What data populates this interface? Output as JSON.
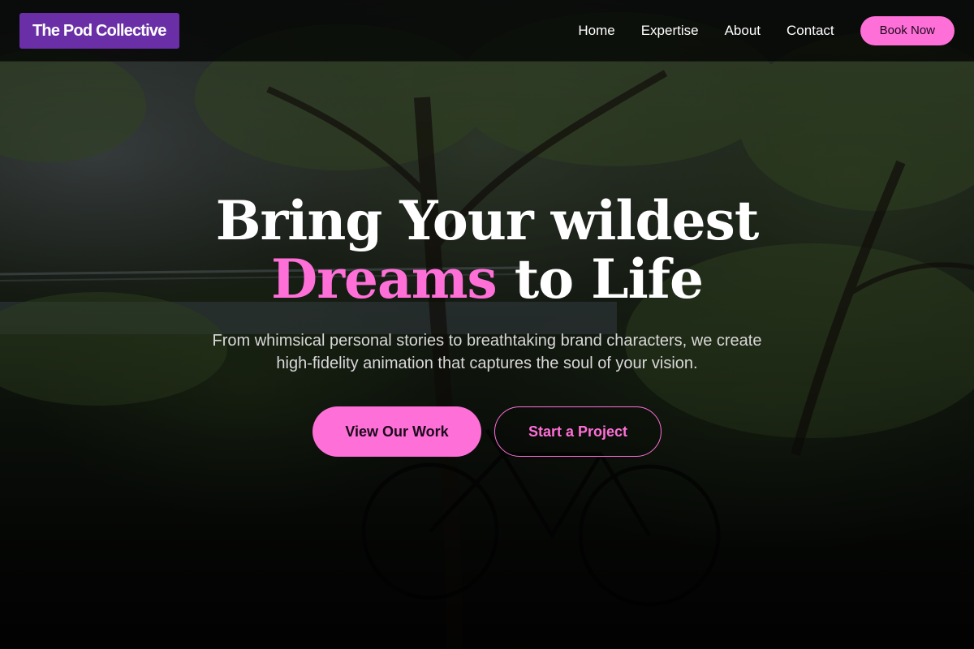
{
  "header": {
    "logo": "The Pod Collective",
    "nav": [
      {
        "label": "Home"
      },
      {
        "label": "Expertise"
      },
      {
        "label": "About"
      },
      {
        "label": "Contact"
      }
    ],
    "book_button": "Book Now"
  },
  "hero": {
    "headline_line1": "Bring Your wildest",
    "headline_accent": "Dreams",
    "headline_rest": " to Life",
    "subtitle": "From whimsical personal stories to breathtaking brand characters, we create high-fidelity animation that captures the soul of your vision.",
    "primary_cta": "View Our Work",
    "secondary_cta": "Start a Project",
    "background": "darkened photo of trees by a river with a bicycle"
  },
  "colors": {
    "accent": "#ff6fd8",
    "logo_bg": "#6a2fa6",
    "header_bg": "#000000"
  }
}
